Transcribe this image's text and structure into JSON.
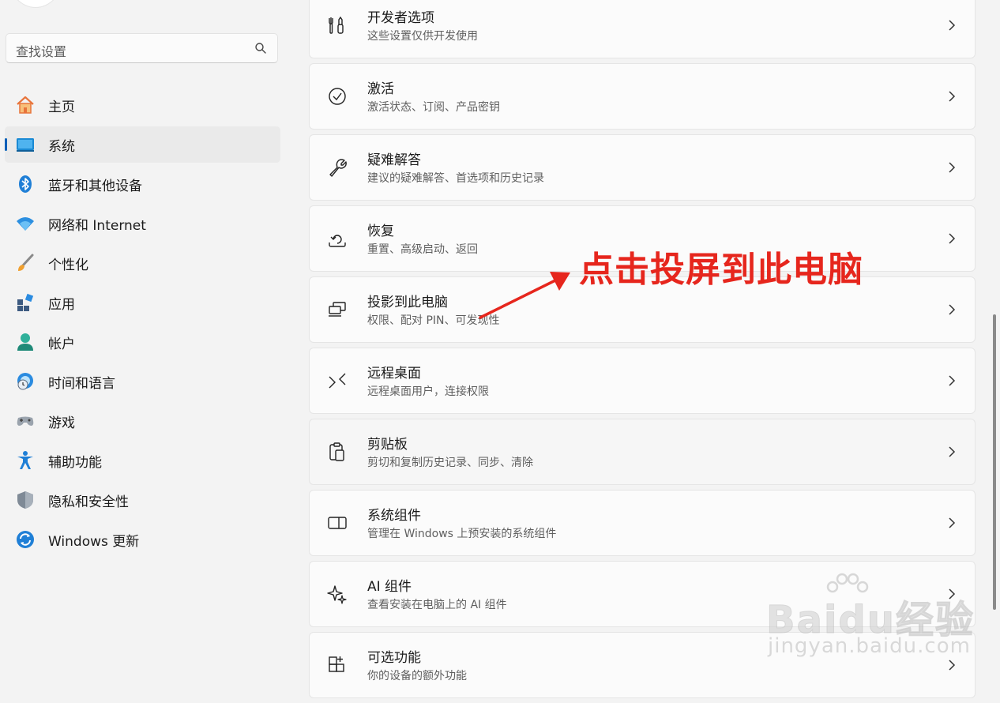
{
  "sidebar": {
    "search_placeholder": "查找设置",
    "items": [
      {
        "label": "主页",
        "icon": "home-icon"
      },
      {
        "label": "系统",
        "icon": "system-display-icon",
        "active": true
      },
      {
        "label": "蓝牙和其他设备",
        "icon": "bluetooth-icon"
      },
      {
        "label": "网络和 Internet",
        "icon": "wifi-icon"
      },
      {
        "label": "个性化",
        "icon": "paintbrush-icon"
      },
      {
        "label": "应用",
        "icon": "apps-icon"
      },
      {
        "label": "帐户",
        "icon": "account-icon"
      },
      {
        "label": "时间和语言",
        "icon": "globe-clock-icon"
      },
      {
        "label": "游戏",
        "icon": "gamepad-icon"
      },
      {
        "label": "辅助功能",
        "icon": "accessibility-icon"
      },
      {
        "label": "隐私和安全性",
        "icon": "shield-icon"
      },
      {
        "label": "Windows 更新",
        "icon": "windows-update-icon"
      }
    ]
  },
  "settings": [
    {
      "title": "开发者选项",
      "subtitle": "这些设置仅供开发使用",
      "icon": "developer-tools-icon"
    },
    {
      "title": "激活",
      "subtitle": "激活状态、订阅、产品密钥",
      "icon": "check-circle-icon"
    },
    {
      "title": "疑难解答",
      "subtitle": "建议的疑难解答、首选项和历史记录",
      "icon": "wrench-icon"
    },
    {
      "title": "恢复",
      "subtitle": "重置、高级启动、返回",
      "icon": "recovery-icon"
    },
    {
      "title": "投影到此电脑",
      "subtitle": "权限、配对 PIN、可发现性",
      "icon": "projection-icon"
    },
    {
      "title": "远程桌面",
      "subtitle": "远程桌面用户，连接权限",
      "icon": "remote-desktop-icon"
    },
    {
      "title": "剪贴板",
      "subtitle": "剪切和复制历史记录、同步、清除",
      "icon": "clipboard-icon"
    },
    {
      "title": "系统组件",
      "subtitle": "管理在 Windows 上预安装的系统组件",
      "icon": "system-components-icon"
    },
    {
      "title": "AI 组件",
      "subtitle": "查看安装在电脑上的 AI 组件",
      "icon": "sparkle-icon"
    },
    {
      "title": "可选功能",
      "subtitle": "你的设备的额外功能",
      "icon": "optional-features-icon"
    }
  ],
  "annotation": {
    "text": "点击投屏到此电脑",
    "color": "#e6261d"
  },
  "watermark": {
    "main": "Baidu经验",
    "sub": "jingyan.baidu.com"
  },
  "colors": {
    "accent": "#005fb8"
  }
}
